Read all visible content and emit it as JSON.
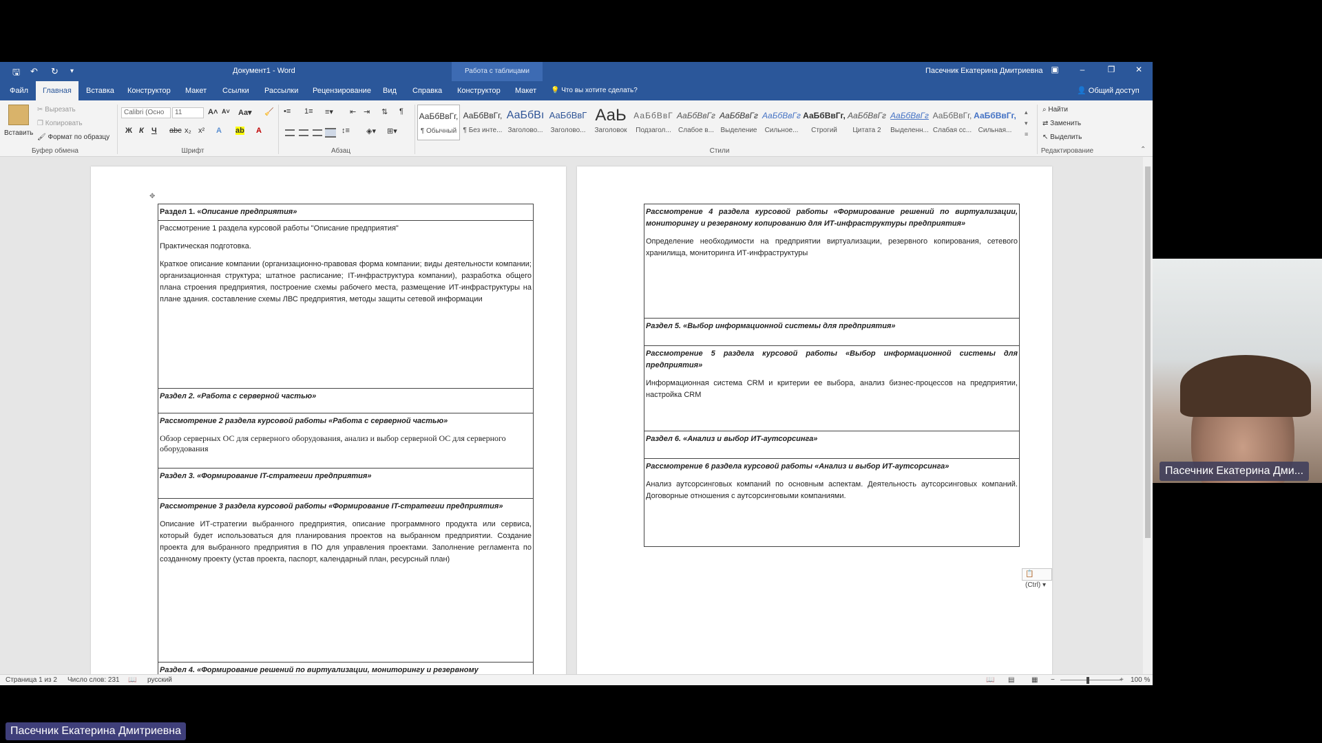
{
  "title_bar": {
    "doc_title": "Документ1 - Word",
    "context_tab": "Работа с таблицами",
    "user": "Пасечник Екатерина Дмитриевна"
  },
  "tabs": [
    "Файл",
    "Главная",
    "Вставка",
    "Конструктор",
    "Макет",
    "Ссылки",
    "Рассылки",
    "Рецензирование",
    "Вид",
    "Справка",
    "Конструктор",
    "Макет"
  ],
  "tell_me": "Что вы хотите сделать?",
  "share": "Общий доступ",
  "ribbon": {
    "clipboard": {
      "paste": "Вставить",
      "cut": "Вырезать",
      "copy": "Копировать",
      "format_painter": "Формат по образцу",
      "label": "Буфер обмена"
    },
    "font": {
      "name": "Calibri (Осно",
      "size": "11",
      "label": "Шрифт"
    },
    "paragraph": {
      "label": "Абзац"
    },
    "styles": {
      "label": "Стили",
      "items": [
        {
          "sample": "АаБбВвГг,",
          "name": "¶ Обычный"
        },
        {
          "sample": "АаБбВвГг,",
          "name": "¶ Без инте..."
        },
        {
          "sample": "АаБбВı",
          "name": "Заголово..."
        },
        {
          "sample": "АаБбВвГ",
          "name": "Заголово..."
        },
        {
          "sample": "АаЬ",
          "name": "Заголовок"
        },
        {
          "sample": "АаБбВвГ",
          "name": "Подзагол..."
        },
        {
          "sample": "АаБбВвГг",
          "name": "Слабое в..."
        },
        {
          "sample": "АаБбВвГг",
          "name": "Выделение"
        },
        {
          "sample": "АаБбВвГг",
          "name": "Сильное..."
        },
        {
          "sample": "АаБбВвГг,",
          "name": "Строгий"
        },
        {
          "sample": "АаБбВвГг",
          "name": "Цитата 2"
        },
        {
          "sample": "АаБбВвГг",
          "name": "Выделенн..."
        },
        {
          "sample": "АаБбВвГг,",
          "name": "Слабая сс..."
        },
        {
          "sample": "АаБбВвГг,",
          "name": "Сильная..."
        }
      ]
    },
    "editing": {
      "find": "Найти",
      "replace": "Заменить",
      "select": "Выделить",
      "label": "Редактирование"
    }
  },
  "page1": {
    "s1_head_prefix": "Раздел 1. «",
    "s1_head": "Описание предприятия»",
    "s1_p1": "Рассмотрение 1 раздела курсовой работы \"Описание предприятия\"",
    "s1_p2": "Практическая подготовка.",
    "s1_p3": "Краткое описание компании (организационно-правовая форма компании; виды деятельности компании; организационная структура; штатное расписание; IT-инфраструктура компании), разработка общего плана строения предприятия, построение схемы рабочего места, размещение ИТ-инфраструктуры на плане здания. составление схемы ЛВС предприятия, методы защиты сетевой информации",
    "s2_head": "Раздел 2. «Работа с серверной частью»",
    "s2_review": "Рассмотрение 2 раздела курсовой работы «Работа с серверной частью»",
    "s2_body": "Обзор серверных ОС для серверного оборудования, анализ и выбор серверной ОС для серверного оборудования",
    "s3_head": "Раздел 3. «Формирование IT-стратегии предприятия»",
    "s3_review": "Рассмотрение 3 раздела курсовой работы «Формирование IT-стратегии предприятия»",
    "s3_body": "Описание ИТ-стратегии выбранного предприятия, описание программного продукта или сервиса, который будет использоваться для планирования проектов на выбранном предприятии. Создание проекта для выбранного предприятия в ПО для управления проектами. Заполнение регламента по созданному проекту (устав проекта, паспорт, календарный план, ресурсный план)",
    "s4_head": "Раздел 4. «Формирование решений по виртуализации, мониторингу и резервному"
  },
  "page2": {
    "s4_review": "Рассмотрение 4 раздела курсовой работы «Формирование решений по виртуализации, мониторингу и резервному копированию для ИТ-инфраструктуры предприятия»",
    "s4_body": "Определение необходимости на предприятии виртуализации, резервного копирования, сетевого хранилища, мониторинга ИТ-инфраструктуры",
    "s5_head": "Раздел 5. «Выбор информационной системы для предприятия»",
    "s5_review": "Рассмотрение 5 раздела курсовой работы «Выбор информационной системы для предприятия»",
    "s5_body": "Информационная система CRM и критерии ее выбора, анализ бизнес-процессов на предприятии, настройка CRM",
    "s6_head": "Раздел 6. «Анализ и выбор ИТ-аутсорсинга»",
    "s6_review": "Рассмотрение 6 раздела курсовой работы «Анализ и выбор ИТ-аутсорсинга»",
    "s6_body": "Анализ аутсорсинговых компаний по основным аспектам. Деятельность аутсорсинговых компаний. Договорные отношения с аутсорсинговыми компаниями.",
    "paste_options": "(Ctrl)"
  },
  "status": {
    "page": "Страница 1 из 2",
    "words": "Число слов: 231",
    "lang": "русский",
    "zoom": "100 %"
  },
  "video": {
    "caption": "Пасечник Екатерина Дми..."
  },
  "presenter_label": "Пасечник Екатерина Дмитриевна"
}
